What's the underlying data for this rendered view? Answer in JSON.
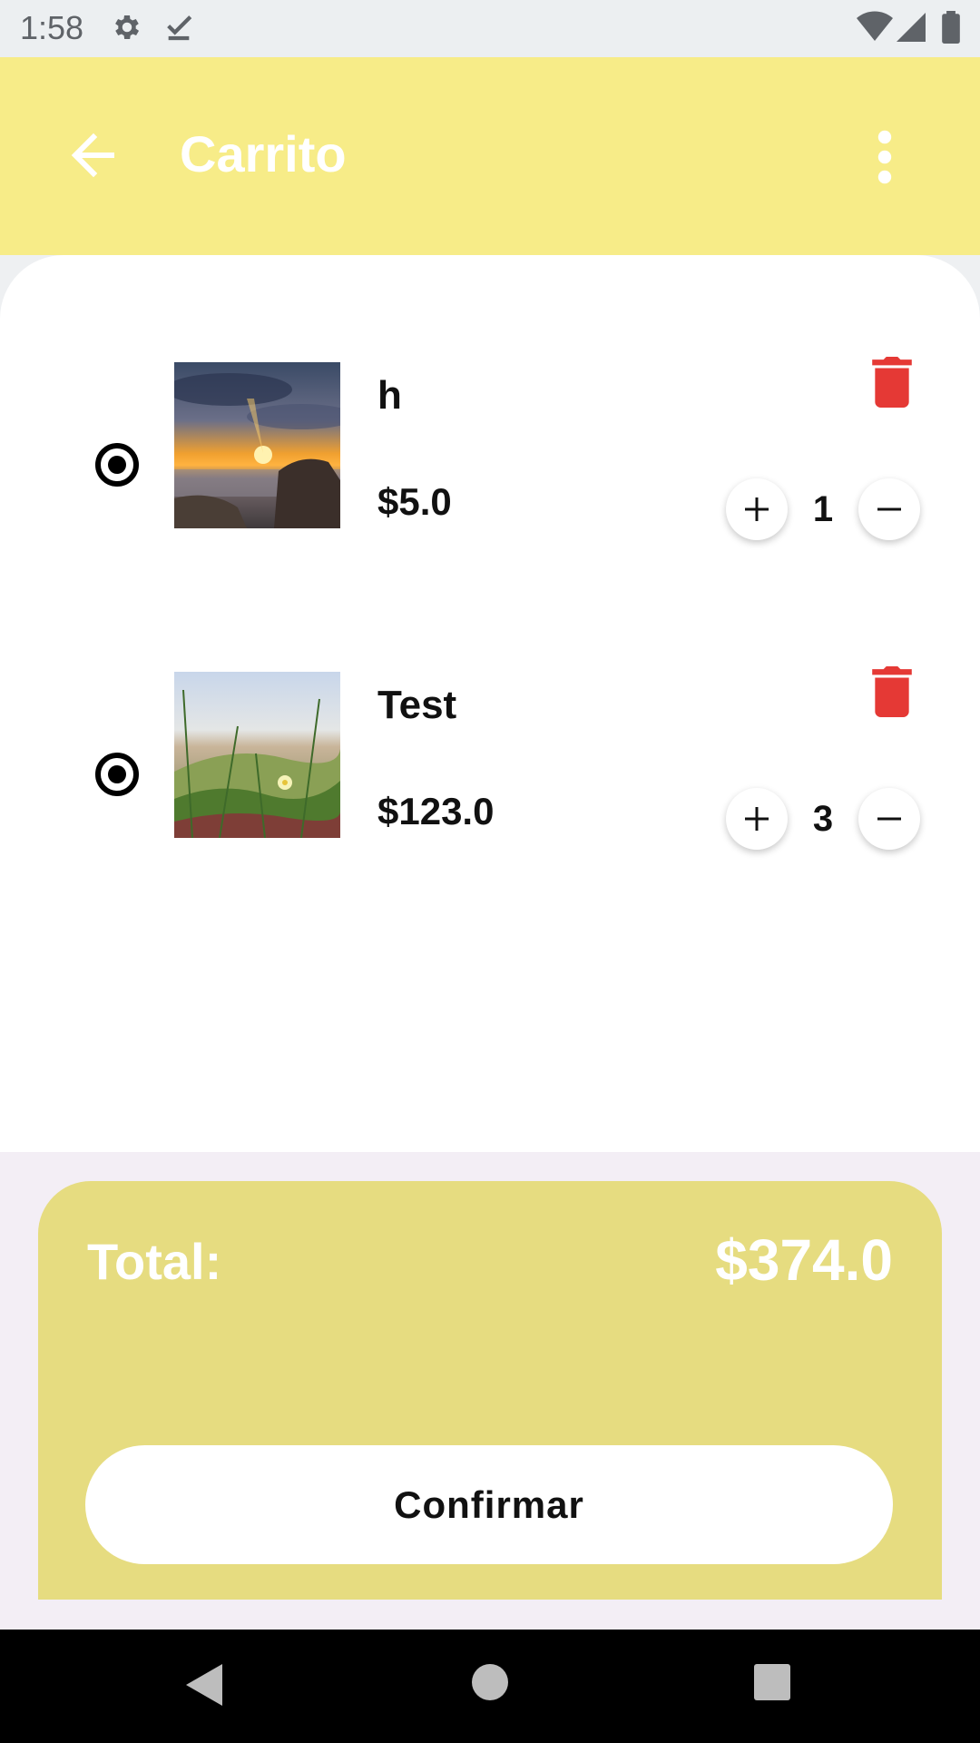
{
  "status_bar": {
    "time": "1:58",
    "icons": [
      "gear-icon",
      "download-done-icon",
      "wifi-icon",
      "signal-icon",
      "battery-icon"
    ]
  },
  "app_bar": {
    "title": "Carrito",
    "back_icon": "arrow-back-icon",
    "menu_icon": "more-vert-icon",
    "color": "#f7ec88"
  },
  "cart": {
    "items": [
      {
        "name": "h",
        "price": "$5.0",
        "quantity": "1",
        "selected": true,
        "image": "sunset-seascape"
      },
      {
        "name": "Test",
        "price": "$123.0",
        "quantity": "3",
        "selected": true,
        "image": "beach-grass-flower"
      }
    ]
  },
  "summary": {
    "total_label": "Total:",
    "total_value": "$374.0",
    "confirm_label": "Confirmar",
    "color": "#e6dc80"
  },
  "nav_bar": {
    "icons": [
      "back-triangle-icon",
      "home-circle-icon",
      "recents-square-icon"
    ]
  },
  "colors": {
    "delete": "#e53935"
  }
}
